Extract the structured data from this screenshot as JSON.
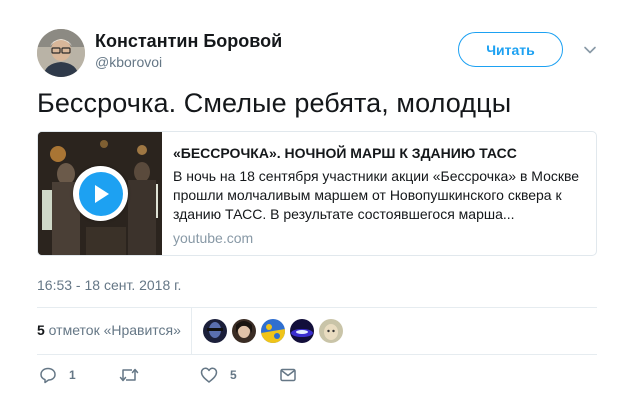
{
  "author": {
    "name": "Константин Боровой",
    "handle": "@kborovoi"
  },
  "follow_label": "Читать",
  "tweet_text": "Бессрочка. Смелые ребята, молодцы",
  "card": {
    "title": "«БЕССРОЧКА». НОЧНОЙ МАРШ К ЗДАНИЮ ТАСС",
    "description": "В ночь на 18 сентября участники акции «Бессрочка» в Москве прошли молчаливым маршем от Новопушкинского сквера к зданию ТАСС. В результате состоявшегося марша...",
    "domain": "youtube.com"
  },
  "timestamp": "16:53 - 18 сент. 2018 г.",
  "likes": {
    "count": "5",
    "label": " отметок «Нравится»"
  },
  "actions": {
    "reply_count": "1",
    "like_count": "5"
  },
  "colors": {
    "accent": "#1da1f2",
    "muted": "#657786",
    "border": "#e1e8ed"
  },
  "icons": [
    "chevron-down-icon",
    "play-icon",
    "reply-icon",
    "retweet-icon",
    "heart-icon",
    "envelope-icon"
  ]
}
